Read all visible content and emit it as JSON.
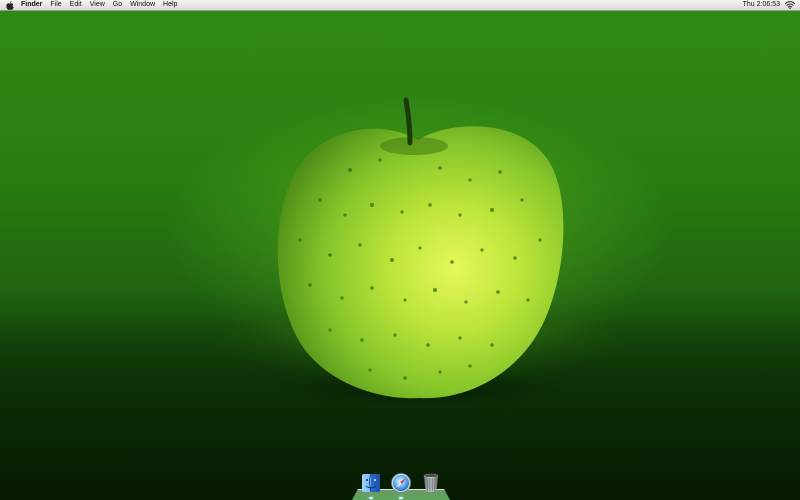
{
  "menubar": {
    "apple_icon": "apple-icon",
    "app_name": "Finder",
    "items": [
      {
        "label": "File"
      },
      {
        "label": "Edit"
      },
      {
        "label": "View"
      },
      {
        "label": "Go"
      },
      {
        "label": "Window"
      },
      {
        "label": "Help"
      }
    ],
    "clock": "Thu 2:06:53",
    "wifi_icon": "wifi-icon"
  },
  "desktop": {
    "wallpaper": "green-apple-photo",
    "accent_colors": {
      "apple": "#b8e83a",
      "background": "#2f8a14",
      "table": "#0d3207"
    }
  },
  "dock": {
    "items": [
      {
        "icon": "finder-icon",
        "running": true
      },
      {
        "icon": "safari-icon",
        "running": true
      },
      {
        "icon": "trash-icon",
        "running": false
      }
    ]
  }
}
